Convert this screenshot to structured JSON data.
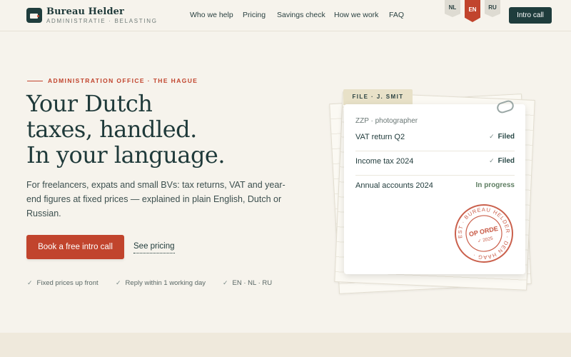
{
  "header": {
    "brand_name": "Bureau Helder",
    "brand_sub": "ADMINISTRATIE · BELASTING",
    "nav": [
      "Who we help",
      "Pricing",
      "Savings check",
      "How we work",
      "FAQ"
    ],
    "languages": [
      {
        "code": "NL",
        "active": false
      },
      {
        "code": "EN",
        "active": true
      },
      {
        "code": "RU",
        "active": false
      }
    ],
    "intro_button": "Intro call"
  },
  "hero": {
    "eyebrow": "ADMINISTRATION OFFICE · THE HAGUE",
    "title_lines": [
      "Your Dutch",
      "taxes, handled.",
      "In your language."
    ],
    "description": "For freelancers, expats and small BVs: tax returns, VAT and year-end figures at fixed prices — explained in plain English, Dutch or Russian.",
    "primary_cta": "Book a free intro call",
    "secondary_cta": "See pricing",
    "features": [
      "Fixed prices up front",
      "Reply within 1 working day",
      "EN · NL · RU"
    ]
  },
  "file_card": {
    "tab_label": "FILE · J. SMIT",
    "subtitle": "ZZP · photographer",
    "rows": [
      {
        "label": "VAT return Q2",
        "status": "Filed"
      },
      {
        "label": "Income tax 2024",
        "status": "Filed"
      },
      {
        "label": "Annual accounts 2024",
        "status": "In progress"
      }
    ],
    "stamp": {
      "ring_text": "EST · BUREAU HELDER · DEN HAAG ·",
      "center_text": "OP ORDE",
      "sub_text": "✓ 2025"
    }
  },
  "colors": {
    "background": "#f6f3ec",
    "primary_dark": "#1f3d3d",
    "accent_red": "#c1442d"
  }
}
